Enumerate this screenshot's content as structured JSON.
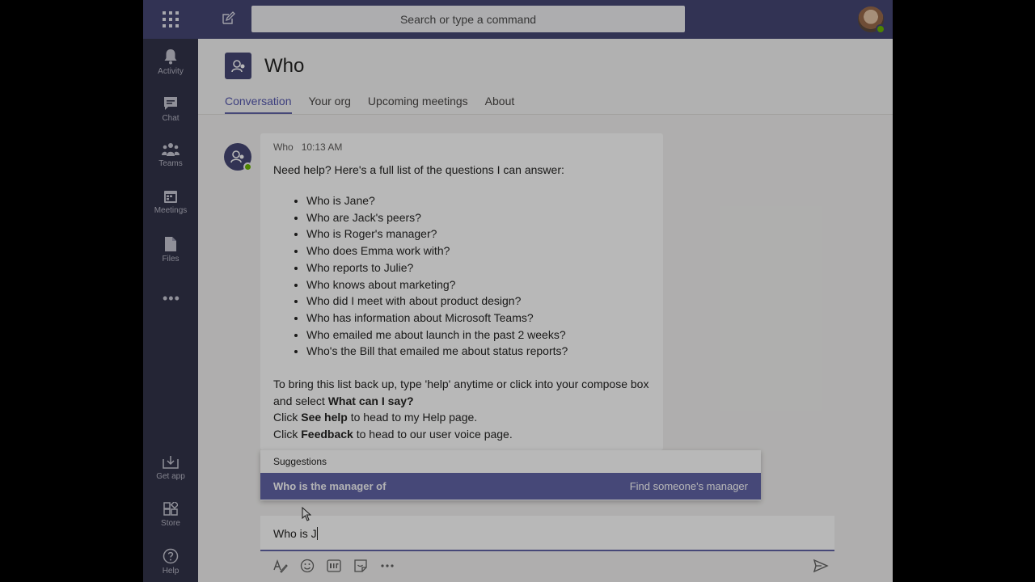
{
  "search": {
    "placeholder": "Search or type a command"
  },
  "rail": {
    "items": [
      {
        "label": "Activity",
        "icon": "bell-icon"
      },
      {
        "label": "Chat",
        "icon": "chat-icon"
      },
      {
        "label": "Teams",
        "icon": "teams-icon"
      },
      {
        "label": "Meetings",
        "icon": "calendar-icon"
      },
      {
        "label": "Files",
        "icon": "file-icon"
      }
    ],
    "more": "•••",
    "bottom": [
      {
        "label": "Get app",
        "icon": "download-icon"
      },
      {
        "label": "Store",
        "icon": "store-icon"
      },
      {
        "label": "Help",
        "icon": "help-icon"
      }
    ]
  },
  "header": {
    "title": "Who",
    "tabs": [
      "Conversation",
      "Your org",
      "Upcoming meetings",
      "About"
    ]
  },
  "message": {
    "sender": "Who",
    "time": "10:13 AM",
    "intro": "Need help? Here's a full list of the questions I can answer:",
    "questions": [
      "Who is Jane?",
      "Who are Jack's peers?",
      "Who is Roger's manager?",
      "Who does Emma work with?",
      "Who reports to Julie?",
      "Who knows about marketing?",
      "Who did I meet with about product design?",
      "Who has information about Microsoft Teams?",
      "Who emailed me about launch in the past 2 weeks?",
      "Who's the Bill that emailed me about status reports?"
    ],
    "outro1_a": "To bring this list back up, type 'help' anytime or click into your compose box and select ",
    "outro1_b": "What can I say?",
    "outro2_a": "Click ",
    "outro2_b": "See help",
    "outro2_c": " to head to my Help page.",
    "outro3_a": "Click ",
    "outro3_b": "Feedback",
    "outro3_c": " to head to our user voice page."
  },
  "suggestions": {
    "header": "Suggestions",
    "item_bold": "Who is",
    "item_rest": " the manager of",
    "item_hint": "Find someone's manager"
  },
  "compose": {
    "value": "Who is J"
  },
  "colors": {
    "brand": "#464775",
    "accent": "#6264a7",
    "rail": "#33344a"
  }
}
